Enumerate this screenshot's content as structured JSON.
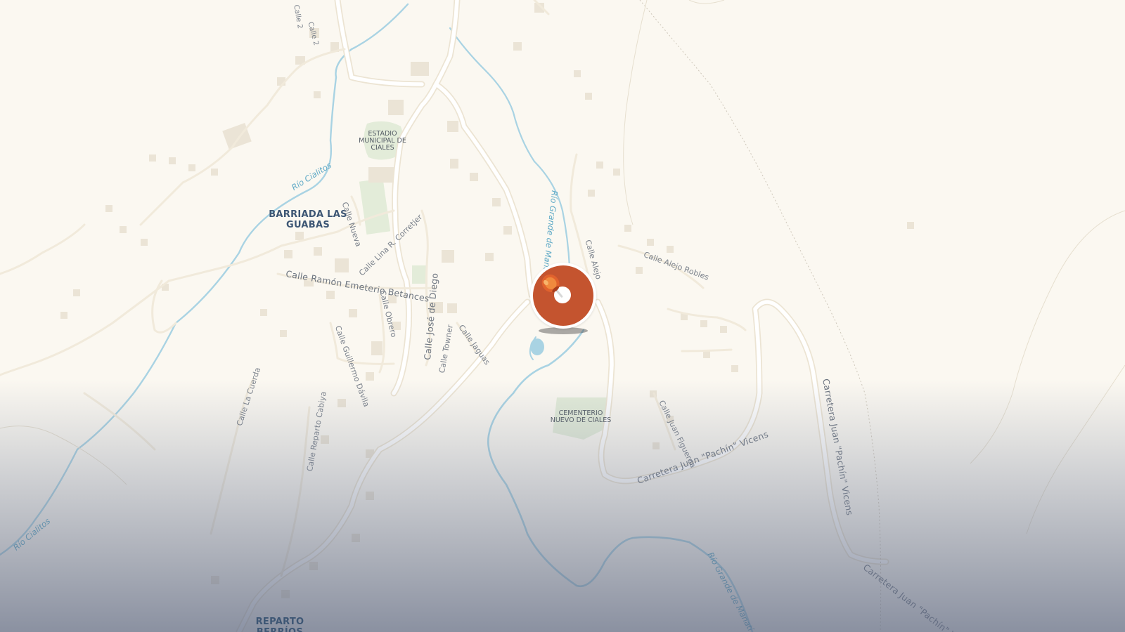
{
  "map": {
    "labels": {
      "calle2_a": "Calle 2",
      "calle2_b": "Calle 2",
      "rio_cialitos_1": "Río Cialitos",
      "rio_cialitos_2": "Río Cialitos",
      "rio_grande_manati_1": "Río Grande de Manatí",
      "rio_grande_manati_2": "Río Grande de Manatí",
      "estadio": "ESTADIO MUNICIPAL DE CIALES",
      "barriada": "BARRIADA LAS GUABAS",
      "calle_nueva": "Calle Nueva",
      "calle_lina": "Calle Lina R. Corretjer",
      "calle_ramon": "Calle Ramón Emeterio Betances",
      "calle_jose": "Calle José de Diego",
      "calle_obrero": "Calle Obrero",
      "calle_towner": "Calle Towner",
      "calle_jaguas": "Calle Jaguas",
      "calle_guillermo": "Calle Guillermo Dávila",
      "calle_la_cuerda": "Calle La Cuerda",
      "calle_reparto": "Calle Reparto Cabiya",
      "calle_alejo": "Calle Alejo",
      "calle_alejo_robles": "Calle Alejo Robles",
      "cementerio": "CEMENTERIO NUEVO DE CIALES",
      "calle_juan_figueroa": "Calle Juan Figueroa",
      "carretera_1": "Carretera Juan \"Pachín\" Vicens",
      "carretera_2": "Carretera Juan \"Pachín\" Vicens",
      "carretera_3": "Carretera Juan \"Pachín\" Vicens",
      "reparto": "REPARTO BERRÍOS"
    },
    "colors": {
      "land": "#fbf8f1",
      "road": "#ffffff",
      "road_casing": "#ece4d3",
      "water": "#a9d3e3",
      "park": "#e3ecd9",
      "building": "#ebe4d6",
      "marker": "#c4542f"
    },
    "marker": {
      "icon": "location-pin-icon"
    }
  }
}
